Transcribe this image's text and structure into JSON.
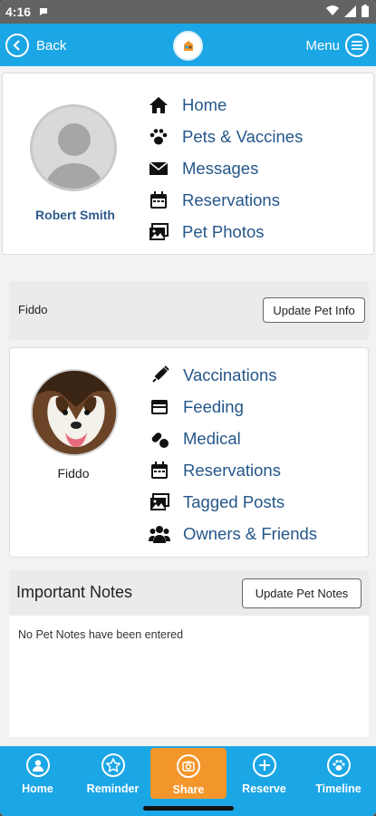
{
  "status": {
    "time": "4:16"
  },
  "header": {
    "back_label": "Back",
    "menu_label": "Menu"
  },
  "owner": {
    "name": "Robert Smith"
  },
  "main_nav": [
    {
      "label": "Home",
      "icon": "home-icon"
    },
    {
      "label": "Pets & Vaccines",
      "icon": "paw-icon"
    },
    {
      "label": "Messages",
      "icon": "envelope-icon"
    },
    {
      "label": "Reservations",
      "icon": "calendar-icon"
    },
    {
      "label": "Pet Photos",
      "icon": "photos-icon"
    }
  ],
  "pet": {
    "name": "Fiddo",
    "update_info_label": "Update Pet Info",
    "photo_name": "Fiddo"
  },
  "pet_nav": [
    {
      "label": "Vaccinations",
      "icon": "syringe-icon"
    },
    {
      "label": "Feeding",
      "icon": "food-bowl-icon"
    },
    {
      "label": "Medical",
      "icon": "pills-icon"
    },
    {
      "label": "Reservations",
      "icon": "calendar-icon"
    },
    {
      "label": "Tagged Posts",
      "icon": "photos-icon"
    },
    {
      "label": "Owners & Friends",
      "icon": "users-icon"
    }
  ],
  "notes": {
    "title": "Important Notes",
    "update_label": "Update Pet Notes",
    "empty_text": "No Pet Notes have been entered"
  },
  "tabs": [
    {
      "label": "Home",
      "icon": "user-circle-icon"
    },
    {
      "label": "Reminder",
      "icon": "star-icon"
    },
    {
      "label": "Share",
      "icon": "camera-icon"
    },
    {
      "label": "Reserve",
      "icon": "plus-circle-icon"
    },
    {
      "label": "Timeline",
      "icon": "paw-circle-icon"
    }
  ],
  "colors": {
    "header": "#1ba6e5",
    "link": "#24568a",
    "share_active": "#f3962b"
  }
}
